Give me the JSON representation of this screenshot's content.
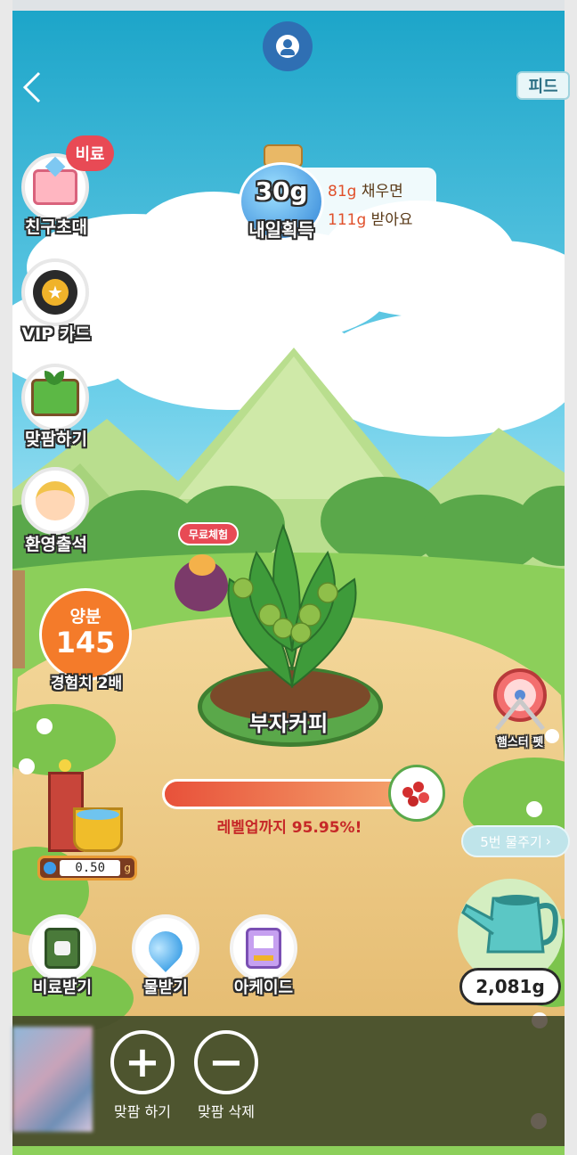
{
  "colors": {
    "sky": "#1fa7c9",
    "nutrient_badge": "#f47b2a",
    "level_text": "#c62828",
    "feed_badge": "#e8f6f8",
    "red_tag": "#e84a55"
  },
  "nav": {
    "back_icon": "chevron-left-icon",
    "profile_icon": "user-icon",
    "feed_label": "피드"
  },
  "reward": {
    "amount": "30g",
    "label": "내일획득",
    "line1_amount": "81g",
    "line1_text": "채우면",
    "line2_amount": "111g",
    "line2_text": "받아요"
  },
  "left_menu": {
    "invite": {
      "label": "친구초대",
      "tag": "비료",
      "icon": "gift-box-icon"
    },
    "vip": {
      "label": "VIP 카드",
      "icon": "star-badge-icon"
    },
    "matpam": {
      "label": "맞팜하기",
      "icon": "sprout-tile-icon"
    },
    "attendance": {
      "label": "환영출석",
      "icon": "farmer-girl-icon"
    }
  },
  "nutrient": {
    "title": "양분",
    "value": "145",
    "sub": "경험치 2배"
  },
  "plant": {
    "free_trial_tag": "무료체험",
    "name": "부자커피",
    "level_progress": 0.9595,
    "level_text": "레벨업까지 95.95%!",
    "reward_icon": "coffee-cherry-icon"
  },
  "hamster": {
    "label": "햄스터 펫",
    "icon": "hamster-wheel-icon"
  },
  "water_tank": {
    "value": "0.50",
    "unit": "g",
    "icon": "water-drop-icon"
  },
  "water_more": {
    "label": "5번 물주기",
    "icon": "chevron-right-icon"
  },
  "watering_can": {
    "amount": "2,081g",
    "icon": "watering-can-icon"
  },
  "actions": {
    "fertilizer": {
      "label": "비료받기",
      "icon": "fertilizer-bag-icon"
    },
    "water": {
      "label": "물받기",
      "icon": "water-drop-icon"
    },
    "arcade": {
      "label": "아케이드",
      "icon": "arcade-machine-icon"
    }
  },
  "bottom": {
    "add_label": "맞팜 하기",
    "remove_label": "맞팜 삭제"
  }
}
